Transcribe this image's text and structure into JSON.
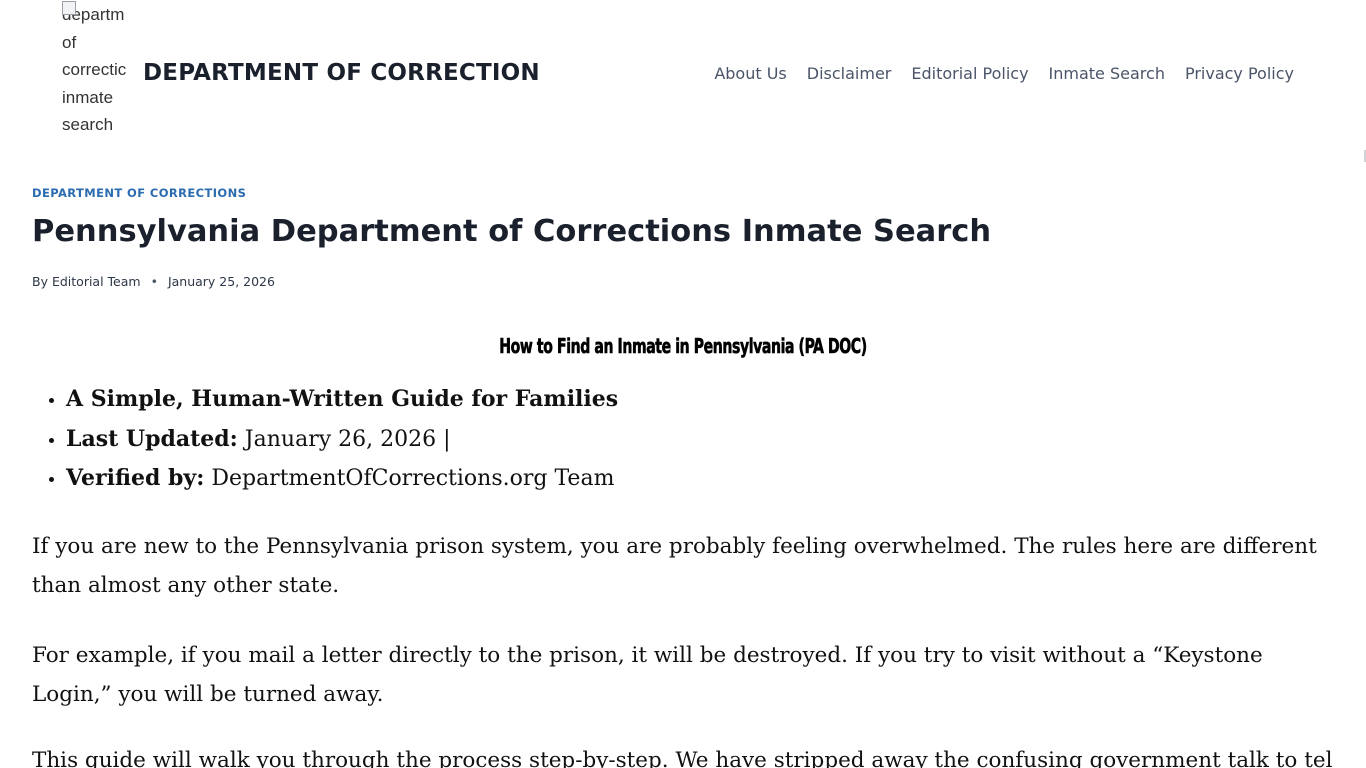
{
  "header": {
    "logo_alt_lines": [
      "departm",
      "of",
      "correctic",
      "inmate",
      "search"
    ],
    "site_title": "DEPARTMENT OF CORRECTION",
    "nav": [
      {
        "label": "About Us"
      },
      {
        "label": "Disclaimer"
      },
      {
        "label": "Editorial Policy"
      },
      {
        "label": "Inmate Search"
      },
      {
        "label": "Privacy Policy"
      }
    ]
  },
  "article": {
    "category": "DEPARTMENT OF CORRECTIONS",
    "title": "Pennsylvania Department of Corrections Inmate Search",
    "meta": {
      "by_prefix": "By",
      "author": "Editorial Team",
      "date": "January 25, 2026"
    },
    "guide_heading": "How to Find an Inmate in Pennsylvania (PA DOC)",
    "info_list": [
      {
        "bold": "A Simple, Human-Written Guide for Families",
        "text": ""
      },
      {
        "bold": "Last Updated:",
        "text": " January 26, 2026 |"
      },
      {
        "bold": "Verified by:",
        "text": " DepartmentOfCorrections.org Team"
      }
    ],
    "paragraphs": [
      "If you are new to the Pennsylvania prison system, you are probably feeling overwhelmed. The rules here are different than almost any other state.",
      "For example, if you mail a letter directly to the prison, it will be destroyed. If you try to visit without a “Keystone Login,” you will be turned away.",
      "This guide will walk you through the process step-by-step. We have stripped away the confusing government talk to tell"
    ]
  },
  "colors": {
    "category_link": "#2b6cb0",
    "nav_text": "#4a5568",
    "title_text": "#1a202c"
  }
}
